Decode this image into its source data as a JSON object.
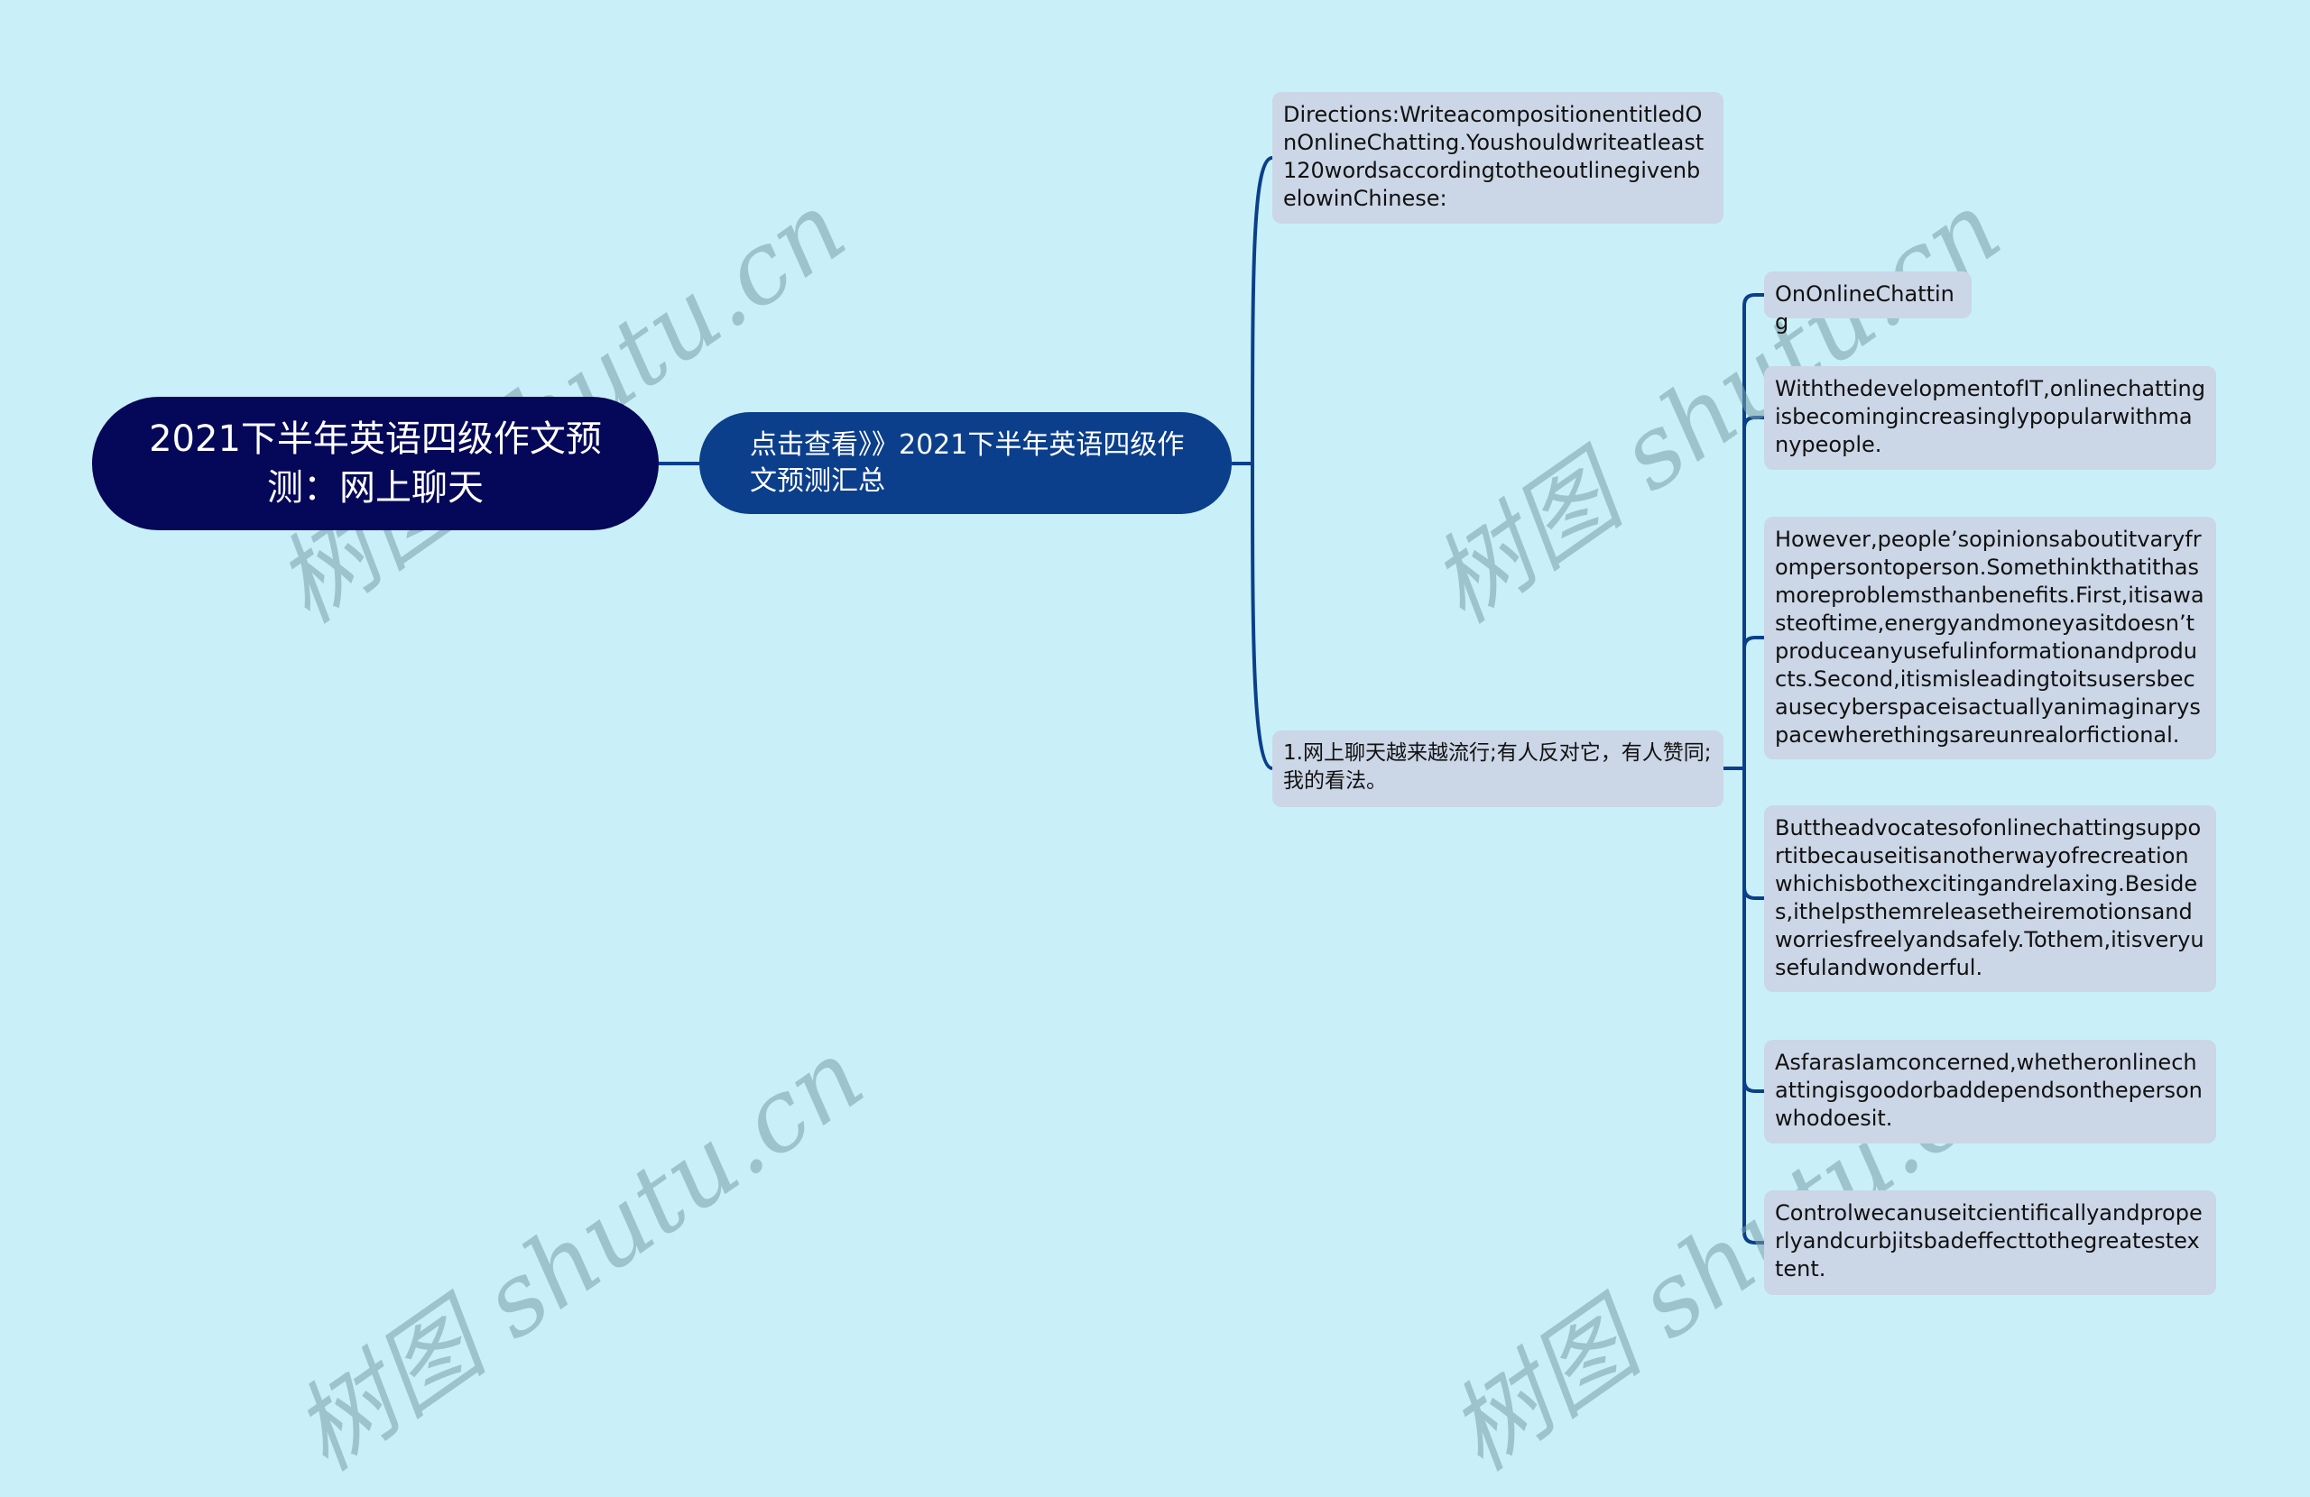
{
  "colors": {
    "background": "#c9f0f8",
    "root_fill": "#050758",
    "level1_fill": "#0b3f8b",
    "leaf_fill": "#cbd6e6",
    "connector": "#0b3f8b"
  },
  "root": {
    "label": "2021下半年英语四级作文预测：网上聊天"
  },
  "level1": {
    "label": "点击查看》》2021下半年英语四级作文预测汇总"
  },
  "level2": [
    {
      "label": "Directions:WriteacompositionentitledOnOnlineChatting.Youshouldwriteatleast120wordsaccordingtotheoutlinegivenbelowinChinese:"
    },
    {
      "label": "1.网上聊天越来越流行;有人反对它，有人赞同;我的看法。"
    }
  ],
  "leaves": [
    {
      "label": "OnOnlineChatting"
    },
    {
      "label": "WiththedevelopmentofIT,onlinechattingisbecomingincreasinglypopularwithmanypeople."
    },
    {
      "label": "However,people’sopinionsaboutitvaryfrompersontoperson.Somethinkthatithasmoreproblemsthanbenefits.First,itisawasteoftime,energyandmoneyasitdoesn’tproduceanyusefulinformationandproducts.Second,itismisleadingtoitsusersbecausecyberspaceisactuallyanimaginaryspacewherethingsareunrealorfictional."
    },
    {
      "label": "Buttheadvocatesofonlinechattingsupportitbecauseitisanotherwayofrecreationwhichisbothexcitingandrelaxing.Besides,ithelpsthemreleasetheiremotionsandworriesfreelyandsafely.Tothem,itisveryusefulandwonderful."
    },
    {
      "label": "AsfarasIamconcerned,whetheronlinechattingisgoodorbaddependsonthepersonwhodoesit."
    },
    {
      "label": "Controlwecanuseitcientificallyandproperlyandcurbjitsbadeffecttothegreatestextent."
    }
  ],
  "watermark": {
    "text": "树图 shutu.cn"
  }
}
